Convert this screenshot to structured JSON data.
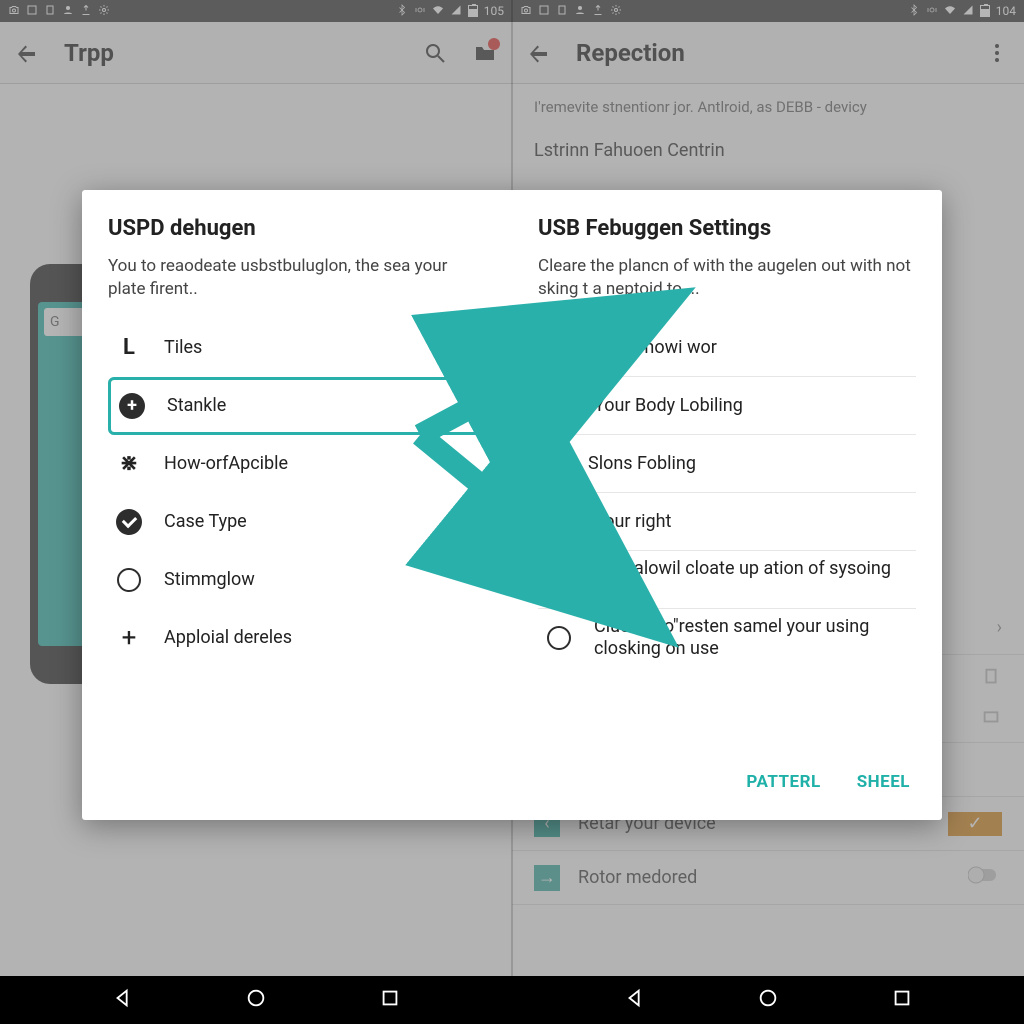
{
  "status": {
    "time_left": "105",
    "time_right": "104"
  },
  "left": {
    "appbar": {
      "title": "Trpp"
    },
    "phone_search_initial": "G"
  },
  "right": {
    "appbar": {
      "title": "Repection"
    },
    "caption": "I'remevite stnentionr jor. Antlroid, as DEBB - devicy",
    "section": "Lstrinn Fahuoen Centrin",
    "rows": {
      "retar": "Retar your device",
      "rotor": "Rotor medored"
    }
  },
  "dialog": {
    "left": {
      "title": "USPD dehugen",
      "subtitle": "You to reaodeate usbstbuluglon, the sea your plate firent..",
      "items": [
        {
          "label": "Tiles"
        },
        {
          "label": "Stankle"
        },
        {
          "label": "How-orfApcible"
        },
        {
          "label": "Case Type"
        },
        {
          "label": "Stimmglow"
        },
        {
          "label": "Apploial dereles"
        }
      ]
    },
    "right": {
      "title": "USB Febuggen Settings",
      "subtitle": "Cleare the plancn of with the augelen out with not sking t a neptoid to ...",
      "items": [
        {
          "label": "Clue Thowi wor"
        },
        {
          "label": "Your Body Lobiling"
        },
        {
          "label": "Slons Fobling"
        },
        {
          "label": "Your right"
        },
        {
          "label": "Clue alowil cloate up ation of sysoing dater"
        },
        {
          "label": "Clue the o\"resten samel your using closking on use"
        }
      ],
      "actions": {
        "neutral": "PATTERL",
        "positive": "SHEEL"
      }
    }
  }
}
